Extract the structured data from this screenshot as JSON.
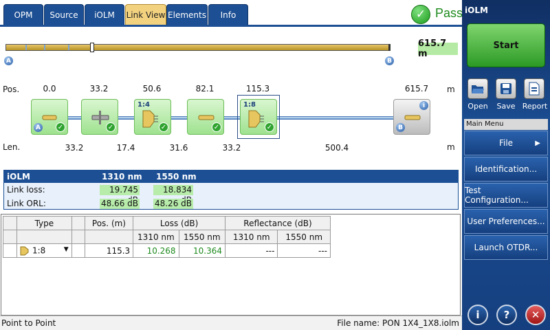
{
  "tabs": [
    {
      "label": "OPM"
    },
    {
      "label": "Source"
    },
    {
      "label": "iOLM"
    },
    {
      "label": "Link View",
      "active": true
    },
    {
      "label": "Elements"
    },
    {
      "label": "Info"
    }
  ],
  "status": {
    "result": "Pass"
  },
  "link": {
    "total_length": "615.7 m",
    "end_a": "A",
    "end_b": "B",
    "pos_label": "Pos.",
    "len_label": "Len.",
    "unit": "m",
    "positions": [
      "0.0",
      "33.2",
      "50.6",
      "82.1",
      "115.3",
      "615.7"
    ],
    "lengths": [
      "33.2",
      "17.4",
      "31.6",
      "33.2",
      "500.4"
    ],
    "elements": [
      {
        "type": "connector",
        "badge": "A"
      },
      {
        "type": "splice"
      },
      {
        "type": "splitter",
        "ratio": "1:4"
      },
      {
        "type": "connector"
      },
      {
        "type": "splitter",
        "ratio": "1:8",
        "selected": true
      },
      {
        "type": "connector",
        "badge": "B",
        "grey": true
      }
    ]
  },
  "summary": {
    "title": "iOLM",
    "col1": "1310 nm",
    "col2": "1550 nm",
    "rows": [
      {
        "label": "Link loss:",
        "v1": "19.745 dB",
        "v2": "18.834 dB"
      },
      {
        "label": "Link ORL:",
        "v1": "48.66 dB",
        "v2": "48.26 dB"
      }
    ]
  },
  "table": {
    "headers": {
      "type": "Type",
      "pos": "Pos. (m)",
      "loss": "Loss (dB)",
      "refl": "Reflectance (dB)"
    },
    "sub": {
      "l1310": "1310 nm",
      "l1550": "1550 nm",
      "r1310": "1310 nm",
      "r1550": "1550 nm"
    },
    "row": {
      "type": "1:8",
      "pos": "115.3",
      "l1310": "10.268",
      "l1550": "10.364",
      "r1310": "---",
      "r1550": "---"
    }
  },
  "statusbar": {
    "left": "Point to Point",
    "right": "File name: PON 1X4_1X8.iolm"
  },
  "panel": {
    "title": "iOLM",
    "start": "Start",
    "tools": [
      {
        "label": "Open"
      },
      {
        "label": "Save"
      },
      {
        "label": "Report"
      }
    ],
    "menu_header": "Main Menu",
    "menu": [
      "File",
      "Identification...",
      "Test Configuration...",
      "User Preferences...",
      "Launch OTDR..."
    ]
  },
  "colors": {
    "accent": "#1c4f94",
    "pass": "#1d8a1d",
    "active_tab": "#f3d27f"
  }
}
